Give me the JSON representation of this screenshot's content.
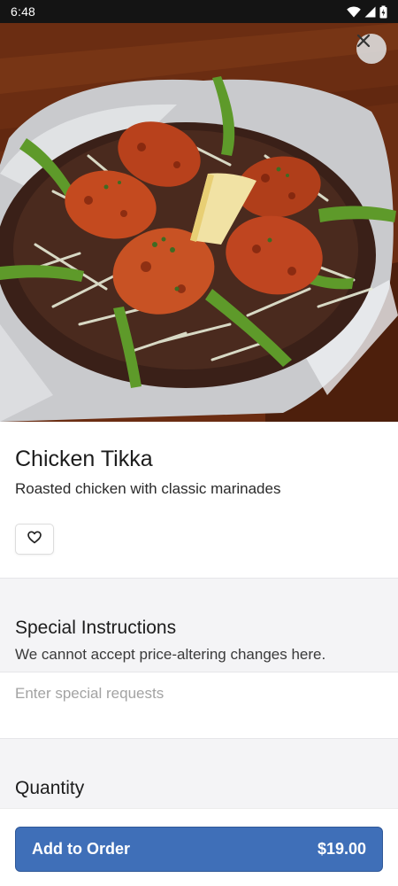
{
  "status_bar": {
    "time": "6:48",
    "icons": [
      "wifi-icon",
      "signal-icon",
      "battery-icon"
    ]
  },
  "item": {
    "name": "Chicken Tikka",
    "description": "Roasted chicken with classic marinades",
    "favorite_icon": "heart-outline-icon"
  },
  "special_instructions": {
    "title": "Special Instructions",
    "subtitle": "We cannot accept price-altering changes here.",
    "placeholder": "Enter special requests",
    "value": ""
  },
  "quantity": {
    "title": "Quantity"
  },
  "order_button": {
    "label": "Add to Order",
    "price": "$19.00"
  },
  "colors": {
    "accent": "#3f6fb8",
    "section_bg": "#f4f4f6",
    "status_bar": "#141414"
  }
}
